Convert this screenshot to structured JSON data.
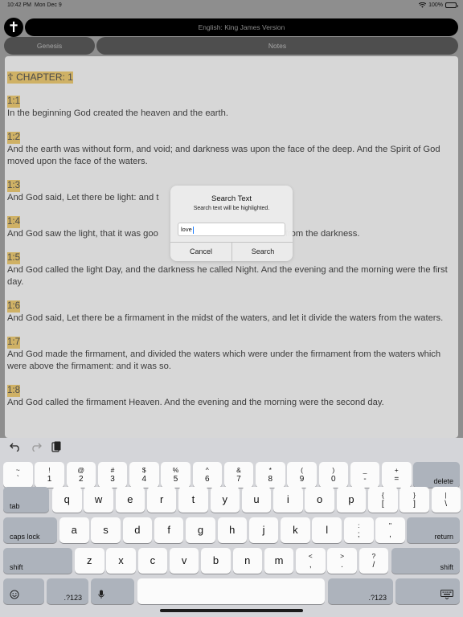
{
  "status_bar": {
    "time": "10:42 PM",
    "date": "Mon Dec 9",
    "battery": "100%",
    "wifi_icon": "wifi-icon"
  },
  "header": {
    "cross_icon": "cross-icon",
    "version": "English: King James Version"
  },
  "tabs": {
    "book": "Genesis",
    "notes": "Notes"
  },
  "reader": {
    "chapter_marker": "☦",
    "chapter": "CHAPTER: 1",
    "verses": [
      {
        "num": "1:1",
        "text": "In the beginning God created the heaven and the earth."
      },
      {
        "num": "1:2",
        "text": "And the earth was without form, and void; and darkness was upon the face of the deep. And the Spirit of God moved upon the face of the waters."
      },
      {
        "num": "1:3",
        "text": "And God said, Let there be light: and t"
      },
      {
        "num": "1:4",
        "text": "And God saw the light, that it was goo",
        "text_tail": "from the darkness."
      },
      {
        "num": "1:5",
        "text": "And God called the light Day, and the darkness he called Night. And the evening and the morning were the first day."
      },
      {
        "num": "1:6",
        "text": "And God said, Let there be a firmament in the midst of the waters, and let it divide the waters from the waters."
      },
      {
        "num": "1:7",
        "text": "And God made the firmament, and divided the waters which were under the firmament from the waters which were above the firmament: and it was so."
      },
      {
        "num": "1:8",
        "text": "And God called the firmament Heaven. And the evening and the morning were the second day."
      }
    ]
  },
  "dialog": {
    "title": "Search Text",
    "message": "Search text will be highlighted.",
    "input_value": "love",
    "cancel": "Cancel",
    "search": "Search"
  },
  "keyboard": {
    "toolbar": {
      "undo_icon": "undo-icon",
      "redo_icon": "redo-icon",
      "paste_icon": "paste-icon"
    },
    "row1": [
      {
        "top": "~",
        "bot": "`"
      },
      {
        "top": "!",
        "bot": "1"
      },
      {
        "top": "@",
        "bot": "2"
      },
      {
        "top": "#",
        "bot": "3"
      },
      {
        "top": "$",
        "bot": "4"
      },
      {
        "top": "%",
        "bot": "5"
      },
      {
        "top": "^",
        "bot": "6"
      },
      {
        "top": "&",
        "bot": "7"
      },
      {
        "top": "*",
        "bot": "8"
      },
      {
        "top": "(",
        "bot": "9"
      },
      {
        "top": ")",
        "bot": "0"
      },
      {
        "top": "_",
        "bot": "-"
      },
      {
        "top": "+",
        "bot": "="
      }
    ],
    "delete": "delete",
    "tab": "tab",
    "row2": [
      "q",
      "w",
      "e",
      "r",
      "t",
      "y",
      "u",
      "i",
      "o",
      "p"
    ],
    "row2_sym": [
      {
        "top": "{",
        "bot": "["
      },
      {
        "top": "}",
        "bot": "]"
      },
      {
        "top": "|",
        "bot": "\\"
      }
    ],
    "caps": "caps lock",
    "row3": [
      "a",
      "s",
      "d",
      "f",
      "g",
      "h",
      "j",
      "k",
      "l"
    ],
    "row3_sym": [
      {
        "top": ":",
        "bot": ";"
      },
      {
        "top": "\"",
        "bot": ","
      }
    ],
    "return": "return",
    "shift": "shift",
    "row4": [
      "z",
      "x",
      "c",
      "v",
      "b",
      "n",
      "m"
    ],
    "row4_sym": [
      {
        "top": "<",
        "bot": ","
      },
      {
        "top": ">",
        "bot": "."
      },
      {
        "top": "?",
        "bot": "/"
      }
    ],
    "num_switch": ".?123",
    "emoji_icon": "emoji-icon",
    "mic_icon": "microphone-icon",
    "hide_icon": "keyboard-hide-icon"
  }
}
